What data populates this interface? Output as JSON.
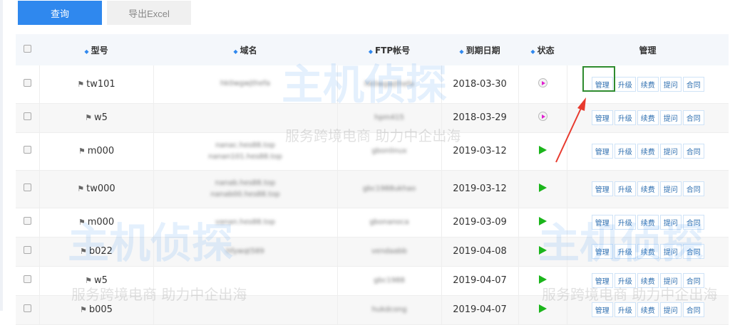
{
  "toolbar": {
    "query_label": "查询",
    "export_label": "导出Excel"
  },
  "table": {
    "headers": [
      "型号",
      "域名",
      "FTP帐号",
      "到期日期",
      "状态",
      "管理"
    ],
    "actions": [
      "管理",
      "升级",
      "续费",
      "提问",
      "合同"
    ],
    "rows": [
      {
        "model": "tw101",
        "domain": [
          "",
          "hk0wgwjthefa",
          ""
        ],
        "ftp": "hk0wgwjthefa",
        "date": "2018-03-30",
        "status": "paused"
      },
      {
        "model": "w5",
        "domain": [
          ""
        ],
        "ftp": "hpm415",
        "date": "2018-03-29",
        "status": "paused"
      },
      {
        "model": "m000",
        "domain": [
          "nanac.hes88.top",
          "nanan101.hes88.top"
        ],
        "ftp": "gbonlinux",
        "date": "2019-03-12",
        "status": "running"
      },
      {
        "model": "tw000",
        "domain": [
          "nanab.hes88.top",
          "nanab00.hes88.top"
        ],
        "ftp": "gbc1988ukhao",
        "date": "2019-03-12",
        "status": "running"
      },
      {
        "model": "m000",
        "domain": [
          "vanan.hes88.top"
        ],
        "ftp": "gbonanoca",
        "date": "2019-03-09",
        "status": "running"
      },
      {
        "model": "b022",
        "domain": [
          "hfywqt589"
        ],
        "ftp": "vendaabb",
        "date": "2019-04-08",
        "status": "running"
      },
      {
        "model": "w5",
        "domain": [
          ""
        ],
        "ftp": "gbc1988",
        "date": "2019-04-07",
        "status": "running"
      },
      {
        "model": "b005",
        "domain": [
          ""
        ],
        "ftp": "hukdcong",
        "date": "2019-04-07",
        "status": "running"
      }
    ]
  },
  "watermark": {
    "brand": "主机侦探",
    "slogan": "服务跨境电商 助力中企出海"
  },
  "colors": {
    "primary": "#2f88ee",
    "highlight": "#2e8b2e",
    "arrow": "#e83a2e",
    "running": "#1bb51b"
  }
}
